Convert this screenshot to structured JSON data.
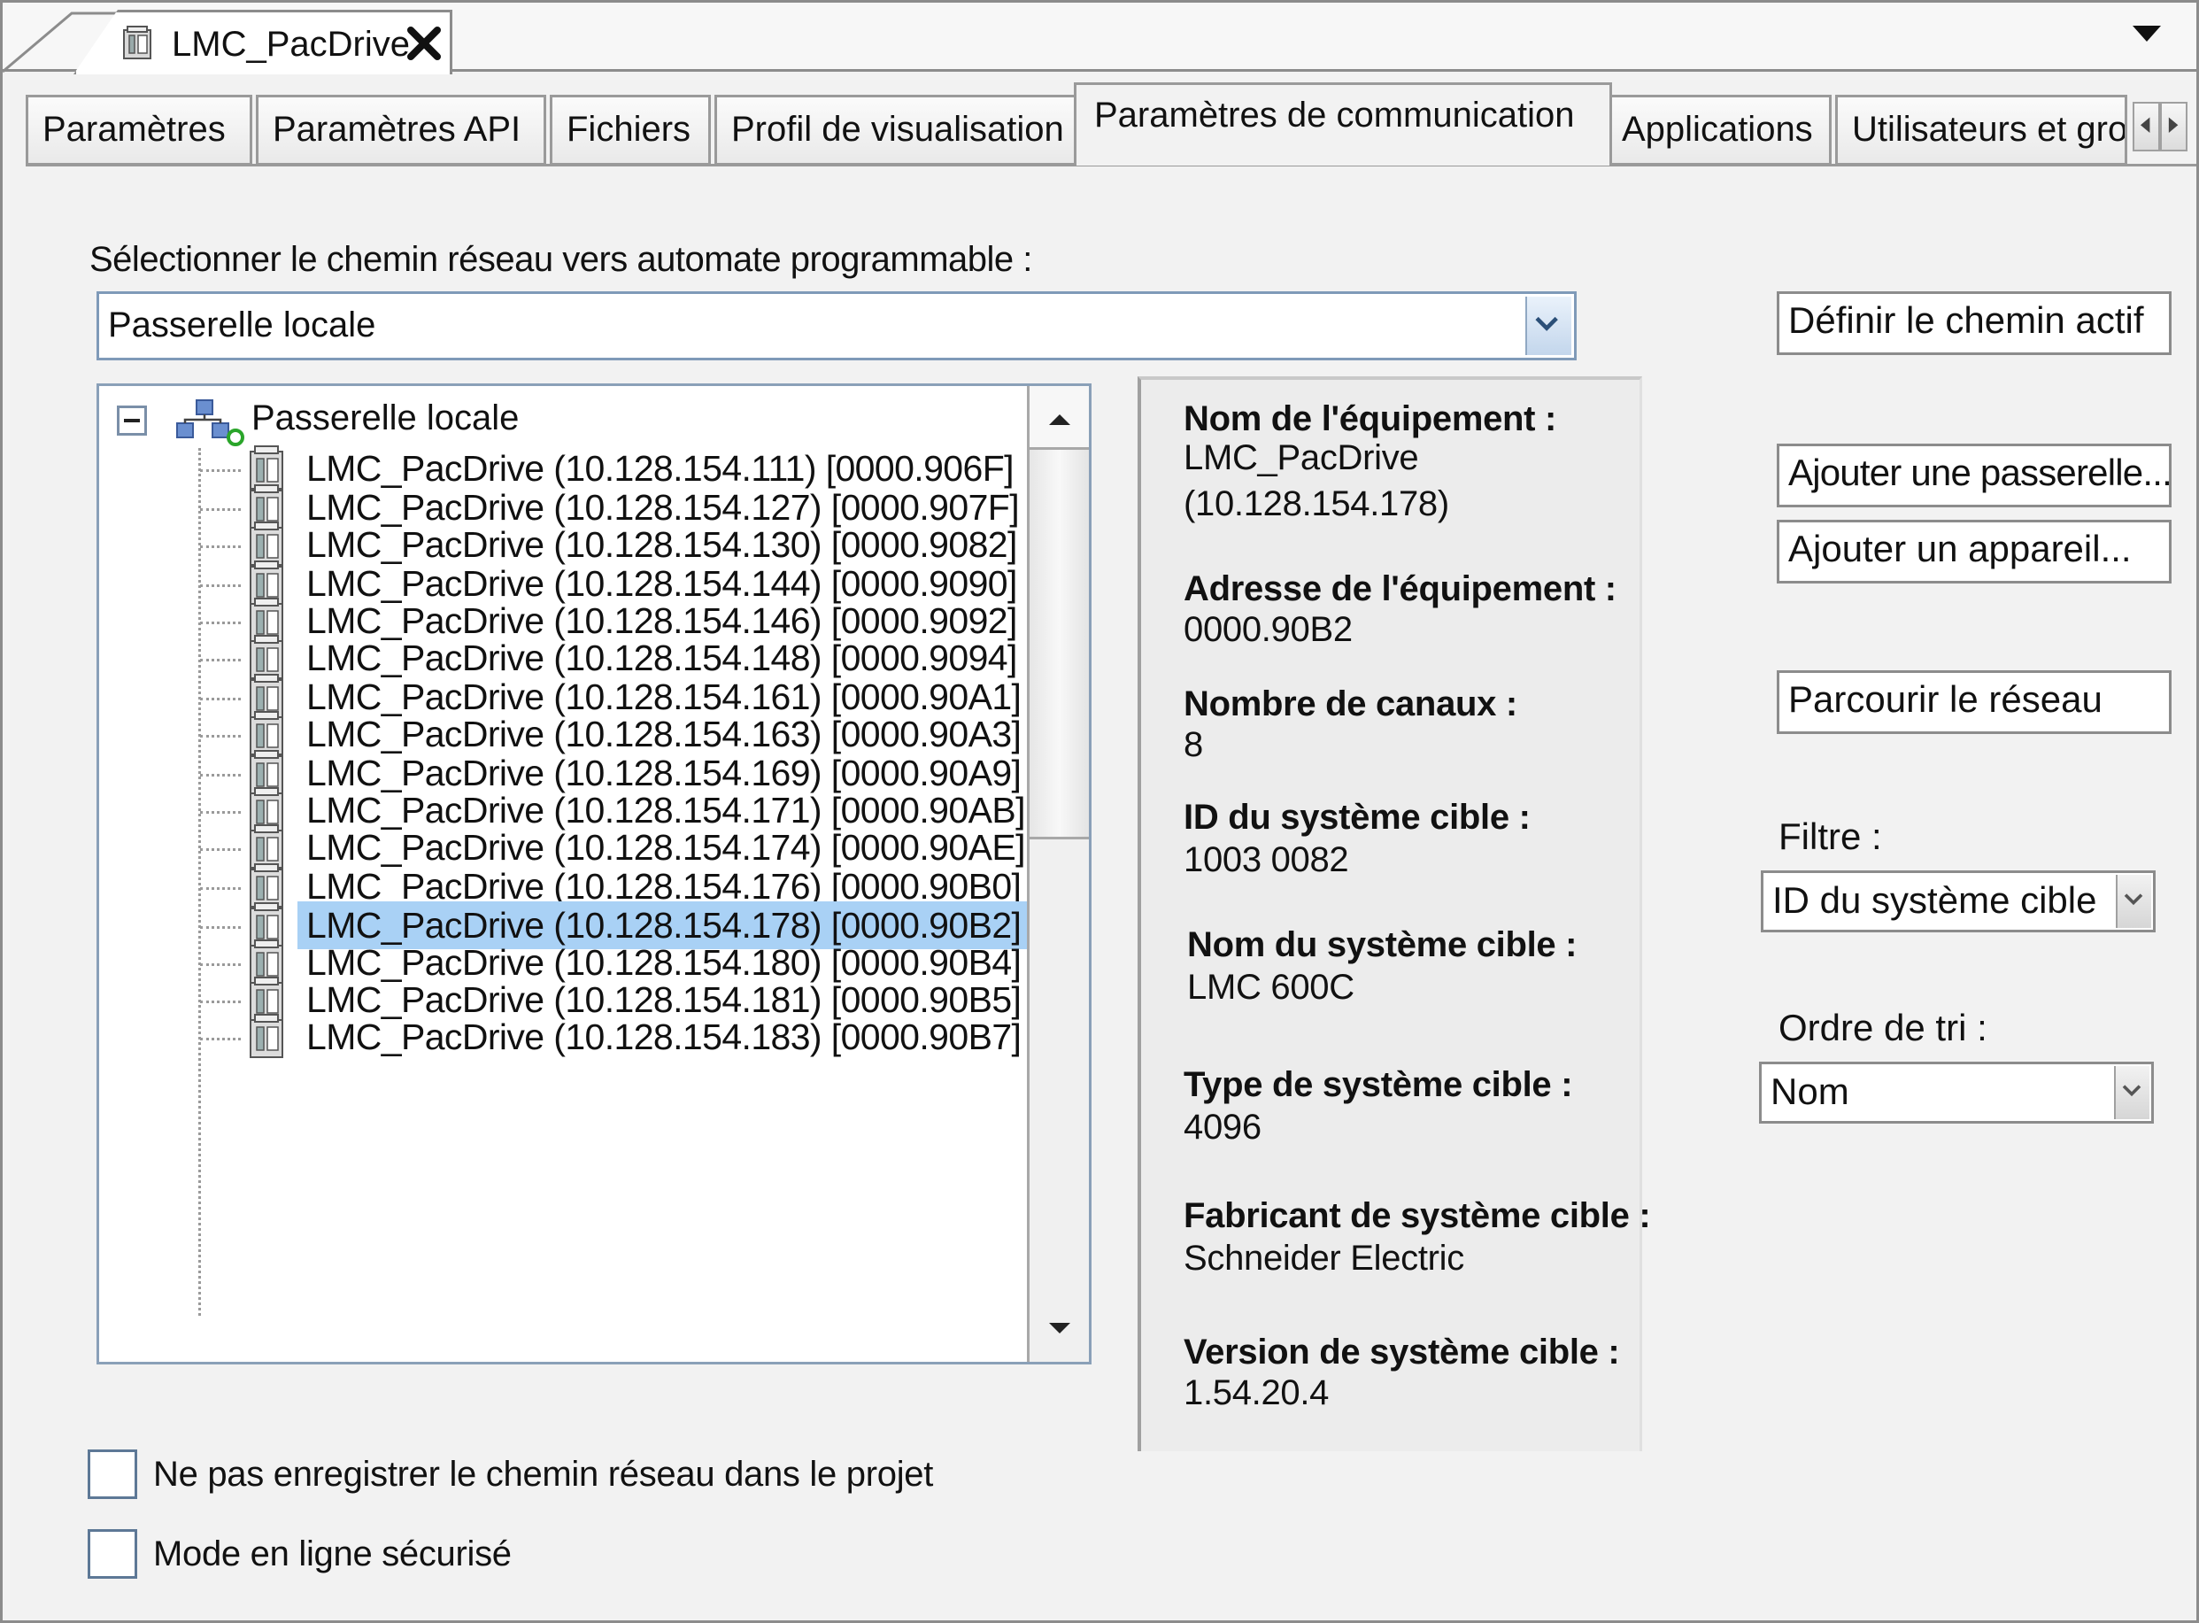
{
  "document_tab": {
    "title": "LMC_PacDrive"
  },
  "tabs": [
    {
      "label": "Paramètres"
    },
    {
      "label": "Paramètres API"
    },
    {
      "label": "Fichiers"
    },
    {
      "label": "Profil de visualisation"
    },
    {
      "label": "Paramètres de communication",
      "active": true
    },
    {
      "label": "Applications"
    },
    {
      "label": "Utilisateurs et groupes"
    }
  ],
  "network_path": {
    "label": "Sélectionner le chemin réseau vers automate programmable :",
    "selected": "Passerelle locale"
  },
  "tree": {
    "root_label": "Passerelle locale",
    "nodes": [
      {
        "label": "LMC_PacDrive (10.128.154.111) [0000.906F]"
      },
      {
        "label": "LMC_PacDrive (10.128.154.127) [0000.907F]"
      },
      {
        "label": "LMC_PacDrive (10.128.154.130) [0000.9082]"
      },
      {
        "label": "LMC_PacDrive (10.128.154.144) [0000.9090]"
      },
      {
        "label": "LMC_PacDrive (10.128.154.146) [0000.9092]"
      },
      {
        "label": "LMC_PacDrive (10.128.154.148) [0000.9094]"
      },
      {
        "label": "LMC_PacDrive (10.128.154.161) [0000.90A1]"
      },
      {
        "label": "LMC_PacDrive (10.128.154.163) [0000.90A3]"
      },
      {
        "label": "LMC_PacDrive (10.128.154.169) [0000.90A9]"
      },
      {
        "label": "LMC_PacDrive (10.128.154.171) [0000.90AB]"
      },
      {
        "label": "LMC_PacDrive (10.128.154.174) [0000.90AE]"
      },
      {
        "label": "LMC_PacDrive (10.128.154.176) [0000.90B0]"
      },
      {
        "label": "LMC_PacDrive (10.128.154.178) [0000.90B2]",
        "selected": true
      },
      {
        "label": "LMC_PacDrive (10.128.154.180) [0000.90B4]"
      },
      {
        "label": "LMC_PacDrive (10.128.154.181) [0000.90B5]"
      },
      {
        "label": "LMC_PacDrive (10.128.154.183) [0000.90B7]"
      }
    ]
  },
  "details": {
    "device_name_label": "Nom de l'équipement :",
    "device_name_line1": "LMC_PacDrive",
    "device_name_line2": "(10.128.154.178)",
    "device_address_label": "Adresse de l'équipement :",
    "device_address": "0000.90B2",
    "channels_label": "Nombre de canaux :",
    "channels": "8",
    "target_id_label": "ID du système cible :",
    "target_id": "1003 0082",
    "target_name_label": "Nom du système cible :",
    "target_name": "LMC 600C",
    "target_type_label": "Type de système cible :",
    "target_type": "4096",
    "target_vendor_label": "Fabricant de système cible :",
    "target_vendor": "Schneider Electric",
    "target_version_label": "Version de système cible :",
    "target_version": "1.54.20.4"
  },
  "actions": {
    "set_active_path": "Définir le chemin actif",
    "add_gateway": "Ajouter une passerelle...",
    "add_device": "Ajouter un appareil...",
    "scan_network": "Parcourir le réseau",
    "filter_label": "Filtre :",
    "filter_value": "ID du système cible",
    "sort_label": "Ordre de tri :",
    "sort_value": "Nom"
  },
  "options": {
    "dont_save_path": "Ne pas enregistrer le chemin réseau dans le projet",
    "secure_online": "Mode en ligne sécurisé"
  },
  "colors": {
    "selection": "#a9d1f5",
    "combo_border": "#7f9ab8",
    "panel_bg": "#f2f2f2"
  }
}
